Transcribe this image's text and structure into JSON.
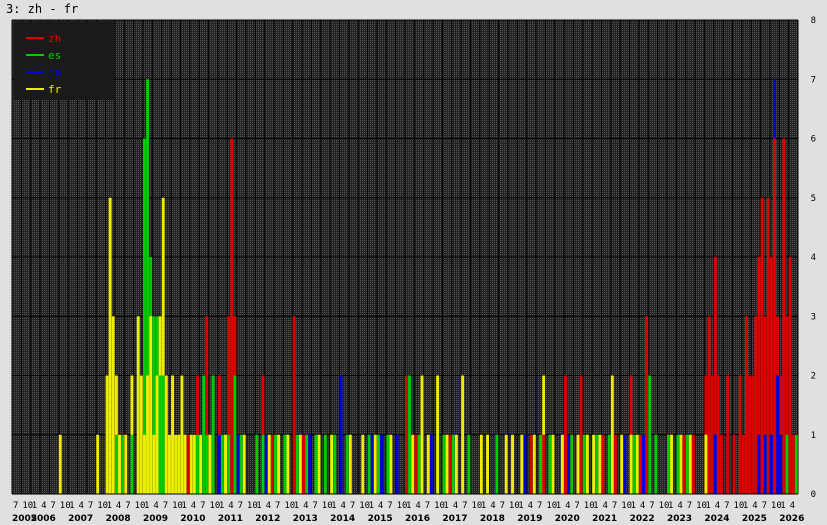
{
  "title": "3: zh - fr",
  "chart_data": {
    "type": "bar",
    "title": "3: zh - fr",
    "xlabel": "",
    "ylabel": "",
    "ylim": [
      0,
      8
    ],
    "yticks": [
      0,
      1,
      2,
      3,
      4,
      5,
      6,
      7,
      8
    ],
    "x_start": "2005-07",
    "x_end": "2026-06",
    "grid": true,
    "legend_position": "top-left",
    "years": [
      "2005",
      "2006",
      "2007",
      "2008",
      "2009",
      "2010",
      "2011",
      "2012",
      "2013",
      "2014",
      "2015",
      "2016",
      "2017",
      "2018",
      "2019",
      "2020",
      "2021",
      "2022",
      "2023",
      "2024",
      "2025",
      "2026"
    ],
    "month_tick_labels": [
      "1",
      "4",
      "7",
      "10"
    ],
    "colors": {
      "background": "#222222",
      "plot_dot": "#555555",
      "grid": "#000000",
      "zh": "#dd0000",
      "es": "#00cc00",
      "ja": "#0000dd",
      "fr": "#eeee00",
      "legend_bg": "#1a1a1a"
    },
    "series": [
      {
        "name": "zh",
        "color": "#dd0000",
        "values": [
          [
            "2010-03",
            1
          ],
          [
            "2010-06",
            2
          ],
          [
            "2010-09",
            3
          ],
          [
            "2010-10",
            1
          ],
          [
            "2011-01",
            2
          ],
          [
            "2011-02",
            1
          ],
          [
            "2011-04",
            3
          ],
          [
            "2011-05",
            6
          ],
          [
            "2011-06",
            3
          ],
          [
            "2012-03",
            2
          ],
          [
            "2012-06",
            1
          ],
          [
            "2013-01",
            3
          ],
          [
            "2013-04",
            1
          ],
          [
            "2016-01",
            2
          ],
          [
            "2016-04",
            1
          ],
          [
            "2017-03",
            1
          ],
          [
            "2019-05",
            1
          ],
          [
            "2019-09",
            1
          ],
          [
            "2020-04",
            2
          ],
          [
            "2020-06",
            1
          ],
          [
            "2020-09",
            2
          ],
          [
            "2021-04",
            1
          ],
          [
            "2021-08",
            1
          ],
          [
            "2022-01",
            2
          ],
          [
            "2022-04",
            1
          ],
          [
            "2022-06",
            3
          ],
          [
            "2022-09",
            1
          ],
          [
            "2023-06",
            1
          ],
          [
            "2023-09",
            1
          ],
          [
            "2024-01",
            2
          ],
          [
            "2024-02",
            3
          ],
          [
            "2024-03",
            2
          ],
          [
            "2024-04",
            4
          ],
          [
            "2024-05",
            2
          ],
          [
            "2024-06",
            1
          ],
          [
            "2024-08",
            2
          ],
          [
            "2024-10",
            1
          ],
          [
            "2024-12",
            2
          ],
          [
            "2025-01",
            1
          ],
          [
            "2025-02",
            3
          ],
          [
            "2025-03",
            2
          ],
          [
            "2025-04",
            2
          ],
          [
            "2025-05",
            3
          ],
          [
            "2025-06",
            4
          ],
          [
            "2025-07",
            5
          ],
          [
            "2025-08",
            3
          ],
          [
            "2025-09",
            5
          ],
          [
            "2025-10",
            4
          ],
          [
            "2025-11",
            6
          ],
          [
            "2025-12",
            3
          ],
          [
            "2026-01",
            2
          ],
          [
            "2026-02",
            6
          ],
          [
            "2026-03",
            3
          ],
          [
            "2026-04",
            4
          ],
          [
            "2026-05",
            1
          ]
        ]
      },
      {
        "name": "es",
        "color": "#00cc00",
        "values": [
          [
            "2008-04",
            1
          ],
          [
            "2008-06",
            1
          ],
          [
            "2008-09",
            1
          ],
          [
            "2009-01",
            6
          ],
          [
            "2009-02",
            7
          ],
          [
            "2009-03",
            4
          ],
          [
            "2009-04",
            3
          ],
          [
            "2009-05",
            3
          ],
          [
            "2009-06",
            2
          ],
          [
            "2009-07",
            2
          ],
          [
            "2009-09",
            1
          ],
          [
            "2009-12",
            1
          ],
          [
            "2010-02",
            1
          ],
          [
            "2010-06",
            1
          ],
          [
            "2010-08",
            2
          ],
          [
            "2010-09",
            1
          ],
          [
            "2010-11",
            2
          ],
          [
            "2011-01",
            1
          ],
          [
            "2011-02",
            1
          ],
          [
            "2011-03",
            1
          ],
          [
            "2011-04",
            1
          ],
          [
            "2011-06",
            2
          ],
          [
            "2011-08",
            1
          ],
          [
            "2012-01",
            1
          ],
          [
            "2012-03",
            1
          ],
          [
            "2012-07",
            1
          ],
          [
            "2012-10",
            1
          ],
          [
            "2013-02",
            1
          ],
          [
            "2013-05",
            1
          ],
          [
            "2013-08",
            1
          ],
          [
            "2013-11",
            1
          ],
          [
            "2014-02",
            1
          ],
          [
            "2014-06",
            1
          ],
          [
            "2015-01",
            1
          ],
          [
            "2015-04",
            1
          ],
          [
            "2015-07",
            1
          ],
          [
            "2016-02",
            2
          ],
          [
            "2016-05",
            1
          ],
          [
            "2016-09",
            1
          ],
          [
            "2017-01",
            1
          ],
          [
            "2017-04",
            1
          ],
          [
            "2017-09",
            1
          ],
          [
            "2018-06",
            1
          ],
          [
            "2019-03",
            1
          ],
          [
            "2019-08",
            1
          ],
          [
            "2019-11",
            1
          ],
          [
            "2020-06",
            1
          ],
          [
            "2020-10",
            1
          ],
          [
            "2021-02",
            1
          ],
          [
            "2021-06",
            1
          ],
          [
            "2022-02",
            1
          ],
          [
            "2022-05",
            1
          ],
          [
            "2022-07",
            2
          ],
          [
            "2022-09",
            1
          ],
          [
            "2023-01",
            1
          ],
          [
            "2023-04",
            1
          ],
          [
            "2023-07",
            1
          ],
          [
            "2025-08",
            1
          ],
          [
            "2026-03",
            1
          ],
          [
            "2026-06",
            1
          ]
        ]
      },
      {
        "name": "ja",
        "color": "#0000dd",
        "values": [
          [
            "2010-07",
            1
          ],
          [
            "2011-01",
            1
          ],
          [
            "2011-07",
            1
          ],
          [
            "2012-04",
            1
          ],
          [
            "2013-06",
            1
          ],
          [
            "2014-04",
            2
          ],
          [
            "2015-02",
            1
          ],
          [
            "2015-05",
            1
          ],
          [
            "2015-10",
            1
          ],
          [
            "2016-09",
            1
          ],
          [
            "2017-05",
            1
          ],
          [
            "2019-03",
            1
          ],
          [
            "2020-05",
            1
          ],
          [
            "2021-11",
            1
          ],
          [
            "2022-05",
            1
          ],
          [
            "2024-04",
            1
          ],
          [
            "2025-06",
            1
          ],
          [
            "2025-08",
            1
          ],
          [
            "2025-10",
            1
          ],
          [
            "2025-11",
            7
          ],
          [
            "2025-12",
            2
          ],
          [
            "2026-01",
            1
          ]
        ]
      },
      {
        "name": "fr",
        "color": "#eeee00",
        "values": [
          [
            "2006-10",
            1
          ],
          [
            "2007-10",
            1
          ],
          [
            "2008-01",
            2
          ],
          [
            "2008-02",
            5
          ],
          [
            "2008-03",
            3
          ],
          [
            "2008-04",
            2
          ],
          [
            "2008-05",
            1
          ],
          [
            "2008-07",
            1
          ],
          [
            "2008-09",
            2
          ],
          [
            "2008-11",
            3
          ],
          [
            "2008-12",
            2
          ],
          [
            "2009-01",
            1
          ],
          [
            "2009-02",
            2
          ],
          [
            "2009-03",
            3
          ],
          [
            "2009-04",
            1
          ],
          [
            "2009-05",
            2
          ],
          [
            "2009-06",
            3
          ],
          [
            "2009-07",
            5
          ],
          [
            "2009-08",
            2
          ],
          [
            "2009-09",
            1
          ],
          [
            "2009-10",
            2
          ],
          [
            "2009-11",
            1
          ],
          [
            "2009-12",
            1
          ],
          [
            "2010-01",
            2
          ],
          [
            "2010-02",
            1
          ],
          [
            "2010-04",
            1
          ],
          [
            "2010-05",
            1
          ],
          [
            "2010-07",
            1
          ],
          [
            "2010-10",
            1
          ],
          [
            "2011-03",
            1
          ],
          [
            "2011-09",
            1
          ],
          [
            "2012-05",
            1
          ],
          [
            "2012-08",
            1
          ],
          [
            "2012-11",
            1
          ],
          [
            "2013-03",
            1
          ],
          [
            "2013-09",
            1
          ],
          [
            "2014-01",
            1
          ],
          [
            "2014-07",
            1
          ],
          [
            "2014-11",
            1
          ],
          [
            "2015-03",
            1
          ],
          [
            "2015-08",
            1
          ],
          [
            "2016-03",
            1
          ],
          [
            "2016-06",
            2
          ],
          [
            "2016-08",
            1
          ],
          [
            "2016-11",
            2
          ],
          [
            "2017-02",
            1
          ],
          [
            "2017-05",
            1
          ],
          [
            "2017-07",
            2
          ],
          [
            "2018-01",
            1
          ],
          [
            "2018-03",
            1
          ],
          [
            "2018-09",
            1
          ],
          [
            "2018-11",
            1
          ],
          [
            "2019-02",
            1
          ],
          [
            "2019-06",
            1
          ],
          [
            "2019-09",
            2
          ],
          [
            "2019-12",
            1
          ],
          [
            "2020-03",
            1
          ],
          [
            "2020-08",
            1
          ],
          [
            "2020-11",
            1
          ],
          [
            "2021-01",
            1
          ],
          [
            "2021-03",
            1
          ],
          [
            "2021-07",
            2
          ],
          [
            "2021-10",
            1
          ],
          [
            "2022-01",
            1
          ],
          [
            "2022-03",
            1
          ],
          [
            "2023-02",
            1
          ],
          [
            "2023-05",
            1
          ],
          [
            "2023-08",
            1
          ],
          [
            "2024-01",
            1
          ]
        ]
      }
    ]
  }
}
